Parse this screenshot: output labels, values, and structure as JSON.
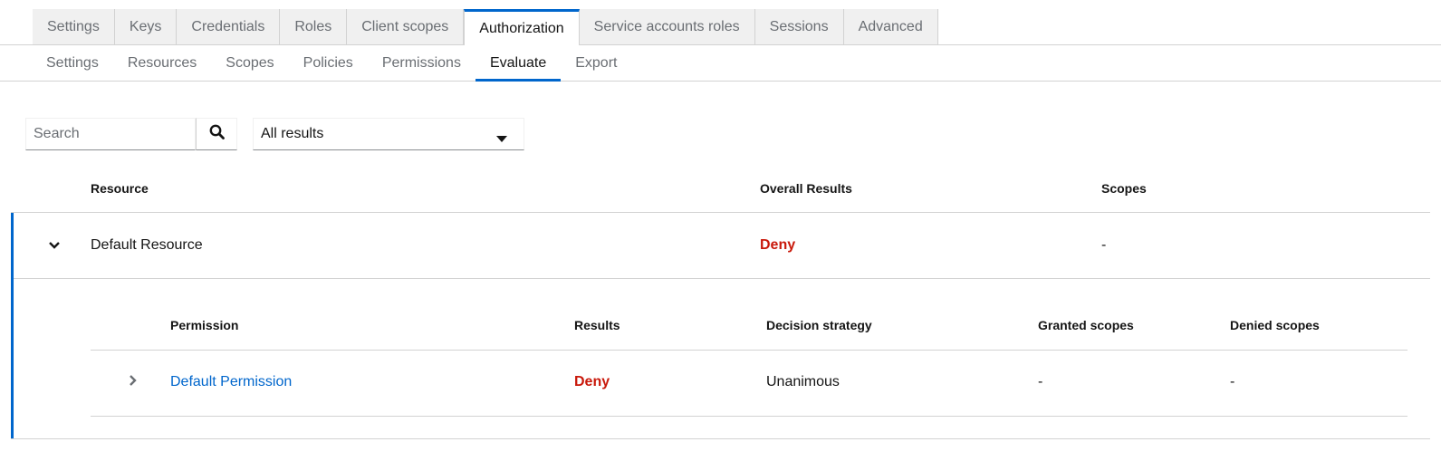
{
  "main_tabs": [
    "Settings",
    "Keys",
    "Credentials",
    "Roles",
    "Client scopes",
    "Authorization",
    "Service accounts roles",
    "Sessions",
    "Advanced"
  ],
  "main_tabs_active": "Authorization",
  "sub_tabs": [
    "Settings",
    "Resources",
    "Scopes",
    "Policies",
    "Permissions",
    "Evaluate",
    "Export"
  ],
  "sub_tabs_active": "Evaluate",
  "toolbar": {
    "search_placeholder": "Search",
    "search_value": "",
    "filter_selected": "All results"
  },
  "table": {
    "headers": {
      "resource": "Resource",
      "overall": "Overall Results",
      "scopes": "Scopes"
    },
    "row": {
      "resource": "Default Resource",
      "overall": "Deny",
      "scopes": "-"
    },
    "expanded": {
      "headers": {
        "permission": "Permission",
        "results": "Results",
        "strategy": "Decision strategy",
        "granted": "Granted scopes",
        "denied": "Denied scopes"
      },
      "row": {
        "permission": "Default Permission",
        "results": "Deny",
        "strategy": "Unanimous",
        "granted": "-",
        "denied": "-"
      }
    }
  },
  "colors": {
    "accent": "#0066cc",
    "deny": "#c9190b",
    "border": "#d2d2d2",
    "inactive_tab_bg": "#f0f0f0"
  },
  "icons": {
    "search": "search-icon",
    "caret": "caret-down-icon",
    "row_toggle": "chevron-down-icon",
    "nested_toggle": "chevron-right-icon"
  }
}
